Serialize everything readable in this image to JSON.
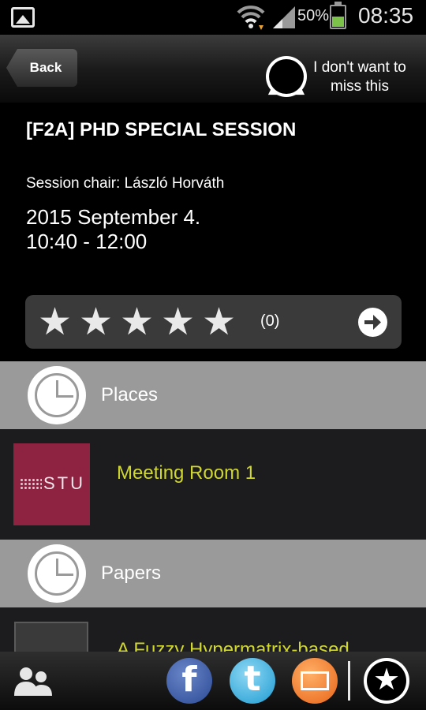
{
  "status_bar": {
    "battery_text": "50%",
    "battery_level": 0.5,
    "time": "08:35",
    "icons": [
      "gallery-icon",
      "wifi-icon",
      "signal-icon",
      "battery-icon"
    ]
  },
  "header": {
    "back_label": "Back",
    "remind_line1": "I don't want to",
    "remind_line2": "miss this",
    "remind_icon": "alert-icon"
  },
  "session": {
    "title": "[F2A] PHD SPECIAL SESSION",
    "chair": "Session chair: László Horváth",
    "date": "2015 September 4.",
    "time_range": "10:40 - 12:00"
  },
  "rating": {
    "stars": [
      "★",
      "★",
      "★",
      "★",
      "★"
    ],
    "count_text": "(0)",
    "arrow_icon": "arrow-right-icon"
  },
  "sections": {
    "places_label": "Places",
    "papers_label": "Papers"
  },
  "places": [
    {
      "logo_text": "STU",
      "name": "Meeting Room 1"
    }
  ],
  "papers": [
    {
      "title": "A Fuzzy Hypermatrix-based"
    }
  ],
  "bottom_bar": {
    "facebook_glyph": "f",
    "twitter_glyph": "t",
    "favorite_glyph": "★",
    "icons": [
      "people-icon",
      "facebook-icon",
      "twitter-icon",
      "mail-icon",
      "star-icon"
    ]
  },
  "colors": {
    "accent_yellow": "#d0d72e",
    "section_gray": "#9a9a9a",
    "stu_maroon": "#8d2341",
    "facebook_blue": "#3b5998",
    "twitter_blue": "#1e9bd1",
    "mail_orange": "#e86418"
  }
}
